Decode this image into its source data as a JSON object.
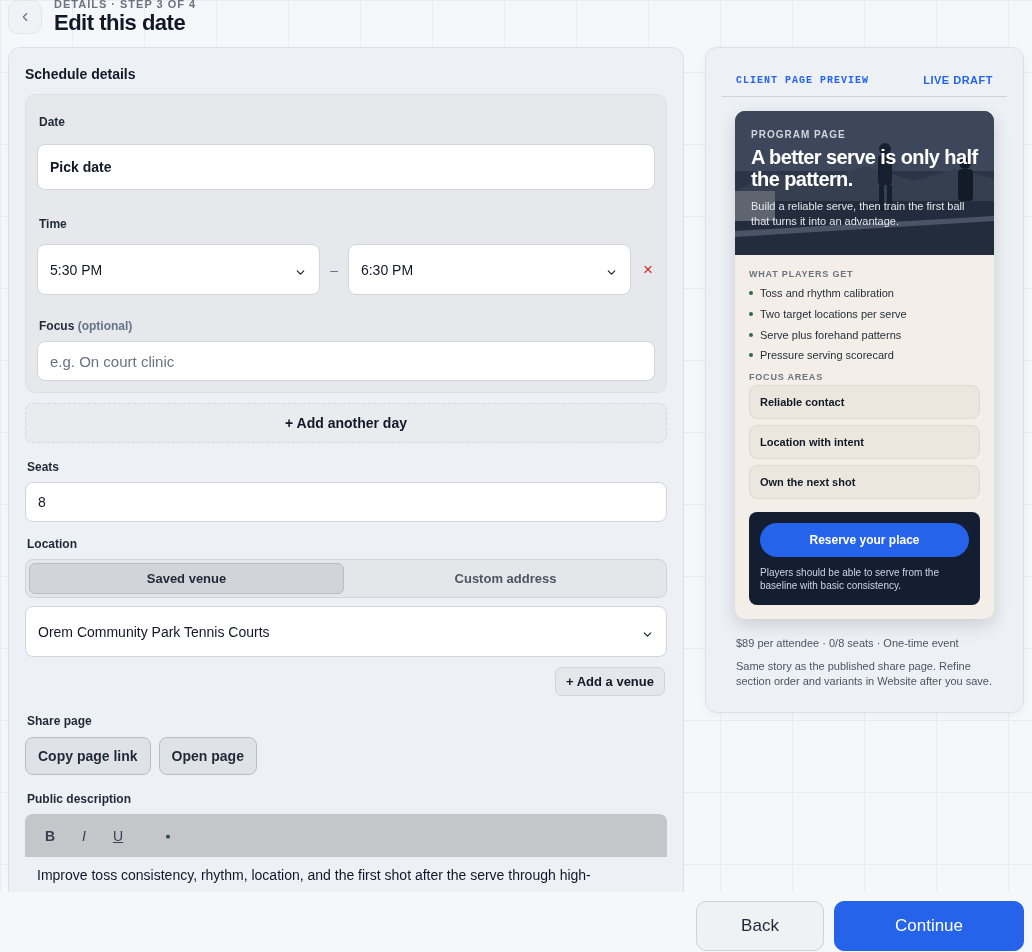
{
  "header": {
    "eyebrow": "DETAILS · STEP 3 OF 4",
    "title": "Edit this date"
  },
  "schedule": {
    "title": "Schedule details",
    "date": {
      "label": "Date",
      "value": "Pick date"
    },
    "time": {
      "label": "Time",
      "start": "5:30 PM",
      "separator": "–",
      "end": "6:30 PM",
      "remove": "×"
    },
    "focus": {
      "label": "Focus",
      "hint": "(optional)",
      "placeholder": "e.g. On court clinic"
    },
    "add_day": "+ Add another day",
    "seats": {
      "label": "Seats",
      "value": "8"
    },
    "location": {
      "label": "Location",
      "options": [
        {
          "label": "Saved venue",
          "selected": true
        },
        {
          "label": "Custom address",
          "selected": false
        }
      ],
      "venue": "Orem Community Park Tennis Courts",
      "add_venue": "+ Add a venue"
    },
    "share": {
      "label": "Share page",
      "buttons": [
        "Copy page link",
        "Open page"
      ]
    },
    "description": {
      "label": "Public description",
      "toolbar": [
        {
          "kind": "bold",
          "label": "B"
        },
        {
          "kind": "italic",
          "label": "I"
        },
        {
          "kind": "underline",
          "label": "U"
        },
        {
          "kind": "list",
          "label": "▪"
        }
      ],
      "text": "Improve toss consistency, rhythm, location, and the first shot after the serve through high-"
    }
  },
  "preview": {
    "label": "CLIENT PAGE PREVIEW",
    "badge": "LIVE DRAFT",
    "card": {
      "eyebrow": "PROGRAM PAGE",
      "headline": "A better serve is only half the pattern.",
      "subhead": "Build a reliable serve, then train the first ball that turns it into an advantage.",
      "gets_title": "WHAT PLAYERS GET",
      "gets": [
        "Toss and rhythm calibration",
        "Two target locations per serve",
        "Serve plus forehand patterns",
        "Pressure serving scorecard"
      ],
      "focus_title": "FOCUS AREAS",
      "focus": [
        "Reliable contact",
        "Location with intent",
        "Own the next shot"
      ],
      "cta": "Reserve your place",
      "cta_note": "Players should be able to serve from the baseline with basic consistency."
    },
    "meta": "$89 per attendee · 0/8 seats · One-time event",
    "note": "Same story as the published share page. Refine section order and variants in Website after you save."
  },
  "footer": {
    "buttons": [
      {
        "label": "Back",
        "kind": "secondary"
      },
      {
        "label": "Continue",
        "kind": "primary"
      }
    ]
  }
}
